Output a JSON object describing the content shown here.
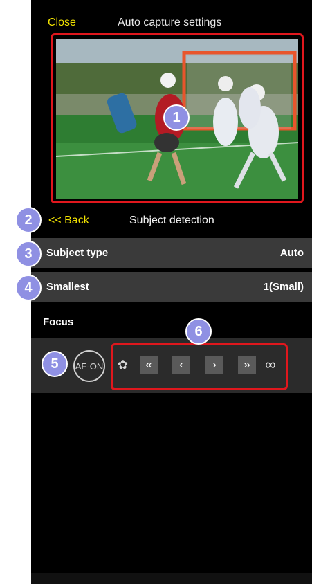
{
  "header": {
    "close_label": "Close",
    "title": "Auto capture settings"
  },
  "nav": {
    "back_label": "<< Back",
    "section_title": "Subject detection"
  },
  "settings": [
    {
      "label": "Subject type",
      "value": "Auto"
    },
    {
      "label": "Smallest",
      "value": "1(Small)"
    }
  ],
  "focus": {
    "section_label": "Focus",
    "af_on_label": "AF-ON",
    "macro_icon": "flower-icon",
    "buttons": [
      "«",
      "‹",
      "›",
      "»"
    ],
    "infinity_label": "∞"
  },
  "callouts": [
    "1",
    "2",
    "3",
    "4",
    "5",
    "6"
  ],
  "colors": {
    "accent": "#f2e300",
    "highlight": "#e0171d",
    "callout": "#8f90e3"
  }
}
